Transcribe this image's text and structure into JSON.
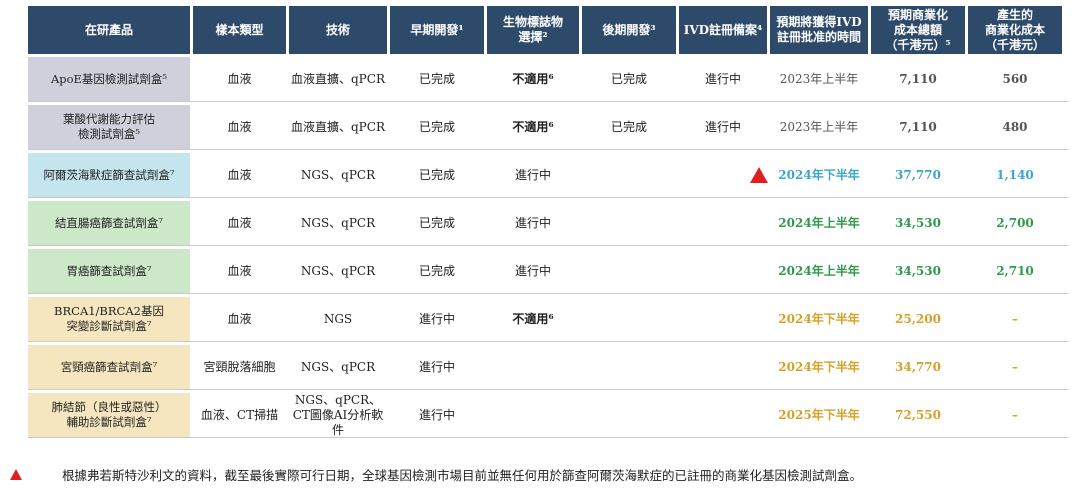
{
  "header": {
    "product": "在研產品",
    "sample": "樣本類型",
    "tech": "技術",
    "early": "早期開發¹",
    "biomarker": "生物標誌物\n選擇²",
    "late": "後期開發³",
    "ivd": "IVD註冊備案⁴",
    "approval": "預期將獲得IVD\n註冊批准的時間",
    "total_cost": "預期商業化\n成本總額\n（千港元）⁵",
    "incurred_cost": "產生的\n商業化成本\n（千港元）"
  },
  "rows": [
    {
      "product": "ApoE基因檢測試劑盒⁵",
      "sample": "血液",
      "tech": "血液直擴、qPCR",
      "early": "已完成",
      "biomarker": "不適用⁶",
      "late": "已完成",
      "ivd": "進行中",
      "approval": "2023年上半年",
      "total_cost": "7,110",
      "incurred_cost": "560"
    },
    {
      "product": "葉酸代謝能力評估\n檢測試劑盒⁵",
      "sample": "血液",
      "tech": "血液直擴、qPCR",
      "early": "已完成",
      "biomarker": "不適用⁶",
      "late": "已完成",
      "ivd": "進行中",
      "approval": "2023年上半年",
      "total_cost": "7,110",
      "incurred_cost": "480"
    },
    {
      "product": "阿爾茨海默症篩查試劑盒⁷",
      "sample": "血液",
      "tech": "NGS、qPCR",
      "early": "已完成",
      "biomarker": "進行中",
      "late": "",
      "ivd": "",
      "approval": "2024年下半年",
      "total_cost": "37,770",
      "incurred_cost": "1,140"
    },
    {
      "product": "結直腸癌篩查試劑盒⁷",
      "sample": "血液",
      "tech": "NGS、qPCR",
      "early": "已完成",
      "biomarker": "進行中",
      "late": "",
      "ivd": "",
      "approval": "2024年上半年",
      "total_cost": "34,530",
      "incurred_cost": "2,700"
    },
    {
      "product": "胃癌篩查試劑盒⁷",
      "sample": "血液",
      "tech": "NGS、qPCR",
      "early": "已完成",
      "biomarker": "進行中",
      "late": "",
      "ivd": "",
      "approval": "2024年上半年",
      "total_cost": "34,530",
      "incurred_cost": "2,710"
    },
    {
      "product": "BRCA1/BRCA2基因\n突變診斷試劑盒⁷",
      "sample": "血液",
      "tech": "NGS",
      "early": "進行中",
      "biomarker": "不適用⁶",
      "late": "",
      "ivd": "",
      "approval": "2024年下半年",
      "total_cost": "25,200",
      "incurred_cost": "–"
    },
    {
      "product": "宮頸癌篩查試劑盒⁷",
      "sample": "宮頸脫落細胞",
      "tech": "NGS、qPCR",
      "early": "進行中",
      "biomarker": "",
      "late": "",
      "ivd": "",
      "approval": "2024年下半年",
      "total_cost": "34,770",
      "incurred_cost": "–"
    },
    {
      "product": "肺結節（良性或惡性）\n輔助診斷試劑盒⁷",
      "sample": "血液、CT掃描",
      "tech": "NGS、qPCR、\nCT圖像AI分析軟件",
      "early": "進行中",
      "biomarker": "",
      "late": "",
      "ivd": "",
      "approval": "2025年下半年",
      "total_cost": "72,550",
      "incurred_cost": "–"
    }
  ],
  "footnote": "根據弗若斯特沙利文的資料，截至最後實際可行日期，全球基因檢測市場目前並無任何用於篩查阿爾茨海默症的已註冊的商業化基因檢測試劑盒。",
  "colors": {
    "header_bg": "#2e4a6b",
    "grey_band": "#d0d0dc",
    "teal_band": "#c4e4ee",
    "green_band": "#cde7c9",
    "yellow_band": "#f6e6bf",
    "triangle": "#e02020"
  },
  "icons": {
    "marker": "red-triangle-icon"
  }
}
